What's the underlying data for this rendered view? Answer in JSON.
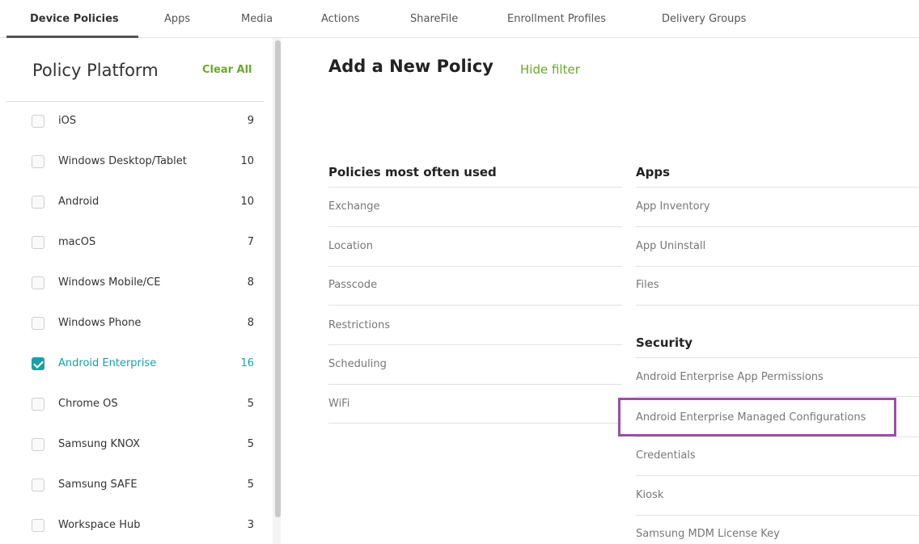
{
  "tabs": [
    {
      "label": "Device Policies",
      "active": true
    },
    {
      "label": "Apps"
    },
    {
      "label": "Media"
    },
    {
      "label": "Actions"
    },
    {
      "label": "ShareFile"
    },
    {
      "label": "Enrollment Profiles"
    },
    {
      "label": "Delivery Groups"
    }
  ],
  "filter": {
    "title": "Policy Platform",
    "clear_all": "Clear All",
    "platforms": [
      {
        "label": "iOS",
        "count": "9",
        "checked": false
      },
      {
        "label": "Windows Desktop/Tablet",
        "count": "10",
        "checked": false
      },
      {
        "label": "Android",
        "count": "10",
        "checked": false
      },
      {
        "label": "macOS",
        "count": "7",
        "checked": false
      },
      {
        "label": "Windows Mobile/CE",
        "count": "8",
        "checked": false
      },
      {
        "label": "Windows Phone",
        "count": "8",
        "checked": false
      },
      {
        "label": "Android Enterprise",
        "count": "16",
        "checked": true
      },
      {
        "label": "Chrome OS",
        "count": "5",
        "checked": false
      },
      {
        "label": "Samsung KNOX",
        "count": "5",
        "checked": false
      },
      {
        "label": "Samsung SAFE",
        "count": "5",
        "checked": false
      },
      {
        "label": "Workspace Hub",
        "count": "3",
        "checked": false
      }
    ]
  },
  "main": {
    "title": "Add a New Policy",
    "hide_filter": "Hide filter",
    "most_used": {
      "heading": "Policies most often used",
      "items": [
        "Exchange",
        "Location",
        "Passcode",
        "Restrictions",
        "Scheduling",
        "WiFi"
      ]
    },
    "apps": {
      "heading": "Apps",
      "items": [
        "App Inventory",
        "App Uninstall",
        "Files"
      ]
    },
    "security": {
      "heading": "Security",
      "items": [
        "Android Enterprise App Permissions",
        "Android Enterprise Managed Configurations",
        "Credentials",
        "Kiosk",
        "Samsung MDM License Key"
      ]
    }
  },
  "colors": {
    "accent_green": "#6aa82d",
    "selected_teal": "#17a0a8",
    "highlight_purple": "#9b4ea6"
  }
}
